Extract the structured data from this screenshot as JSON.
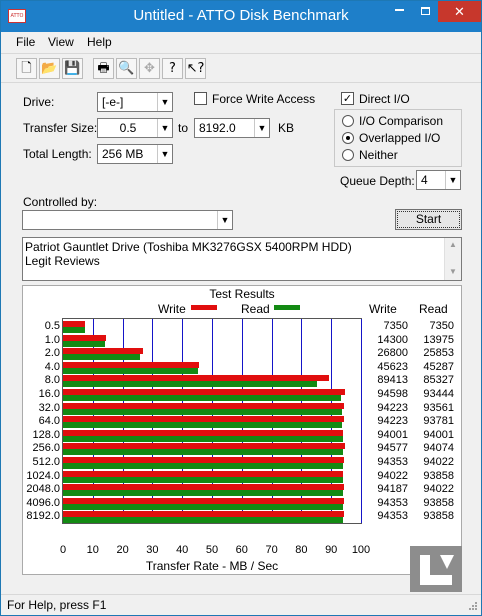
{
  "window": {
    "title": "Untitled - ATTO Disk Benchmark",
    "icon_label": "ATTO"
  },
  "menu": [
    "File",
    "View",
    "Help"
  ],
  "toolbar": [
    "new-file-icon",
    "open-folder-icon",
    "save-icon",
    "print-icon",
    "print-preview-icon",
    "move-icon",
    "help-icon",
    "context-help-icon"
  ],
  "form": {
    "drive_label": "Drive:",
    "drive_value": "[-e-]",
    "force_write_label": "Force Write Access",
    "force_write_checked": false,
    "direct_io_label": "Direct I/O",
    "direct_io_checked": true,
    "transfer_size_label": "Transfer Size:",
    "transfer_from": "0.5",
    "to_label": "to",
    "transfer_to": "8192.0",
    "kb_label": "KB",
    "total_length_label": "Total Length:",
    "total_length_value": "256 MB",
    "io_comparison_label": "I/O Comparison",
    "overlapped_io_label": "Overlapped I/O",
    "neither_label": "Neither",
    "selected_mode": "Overlapped I/O",
    "queue_depth_label": "Queue Depth:",
    "queue_depth_value": "4",
    "controlled_by_label": "Controlled by:",
    "controlled_by_value": "",
    "start_label": "Start",
    "notes_line1": "Patriot Gauntlet Drive (Toshiba MK3276GSX 5400RPM HDD)",
    "notes_line2": "Legit Reviews"
  },
  "results": {
    "title": "Test Results",
    "write_legend": "Write",
    "read_legend": "Read",
    "write_header": "Write",
    "read_header": "Read",
    "write_color": "#e10e0e",
    "read_color": "#138a13",
    "grid_color": "#1515c8"
  },
  "chart_data": {
    "type": "bar",
    "title": "Test Results",
    "xlabel": "Transfer Rate - MB / Sec",
    "xlim": [
      0,
      100
    ],
    "xticks": [
      0,
      10,
      20,
      30,
      40,
      50,
      60,
      70,
      80,
      90,
      100
    ],
    "categories": [
      "0.5",
      "1.0",
      "2.0",
      "4.0",
      "8.0",
      "16.0",
      "32.0",
      "64.0",
      "128.0",
      "256.0",
      "512.0",
      "1024.0",
      "2048.0",
      "4096.0",
      "8192.0"
    ],
    "series": [
      {
        "name": "Write",
        "values": [
          7350,
          14300,
          26800,
          45623,
          89413,
          94598,
          94223,
          94223,
          94001,
          94577,
          94353,
          94022,
          94187,
          94353,
          94353
        ]
      },
      {
        "name": "Read",
        "values": [
          7350,
          13975,
          25853,
          45287,
          85327,
          93444,
          93561,
          93781,
          94001,
          94074,
          94022,
          93858,
          94022,
          93858,
          93858
        ]
      }
    ],
    "legend": "top"
  },
  "status": {
    "text": "For Help, press F1"
  }
}
